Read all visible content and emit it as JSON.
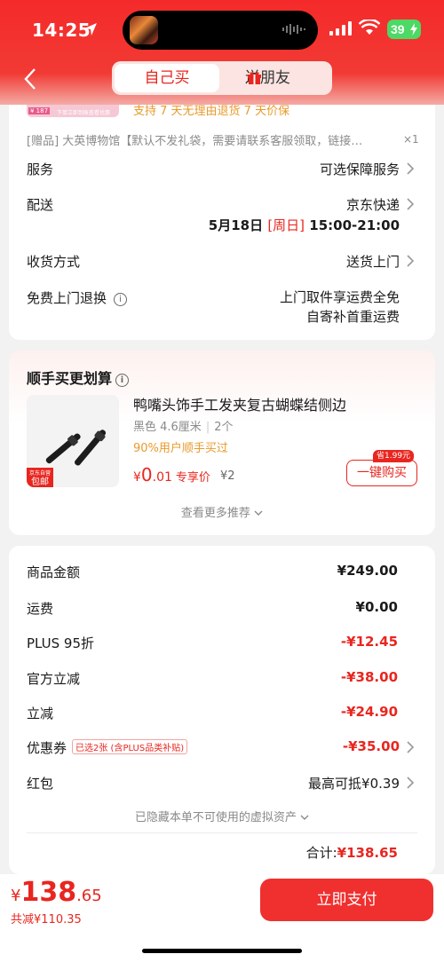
{
  "status_bar": {
    "time": "14:25",
    "battery": "39"
  },
  "header": {
    "tab_self": "自己买",
    "tab_gift": "送朋友"
  },
  "product": {
    "thumb_badge": "¥ 187",
    "thumb_note": "下单立即到账查看优惠",
    "support": "支持 7 天无理由退货  7 天价保",
    "gift_line": "[赠品] 大英博物馆【默认不发礼袋，需要请联系客服领取，链接…",
    "gift_qty": "×1"
  },
  "rows": {
    "service_label": "服务",
    "service_value": "可选保障服务",
    "delivery_label": "配送",
    "delivery_value": "京东快递",
    "delivery_date": "5月18日",
    "delivery_weekday": "[周日]",
    "delivery_time": "15:00-21:00",
    "receive_label": "收货方式",
    "receive_value": "送货上门",
    "return_label": "免费上门退换",
    "return_value_1": "上门取件享运费全免",
    "return_value_2": "自寄补首重运费"
  },
  "bundle": {
    "title": "顺手买更划算",
    "item_title": "鸭嘴头饰手工发夹复古蝴蝶结侧边",
    "spec": "黑色 4.6厘米",
    "count": "2个",
    "pct": "90%用户顺手买过",
    "price_symbol": "¥",
    "price_int": "0",
    "price_dec": ".01",
    "price_tag": "专享价",
    "orig_price": "¥2",
    "save_tag": "省1.99元",
    "buy_label": "一键购买",
    "badge_top": "京东自营",
    "badge_bottom": "包邮",
    "more": "查看更多推荐"
  },
  "summary": {
    "items": [
      {
        "label": "商品金额",
        "value": "¥249.00"
      },
      {
        "label": "运费",
        "value": "¥0.00"
      },
      {
        "label": "PLUS 95折",
        "value": "-¥12.45"
      },
      {
        "label": "官方立减",
        "value": "-¥38.00"
      },
      {
        "label": "立减",
        "value": "-¥24.90"
      },
      {
        "label": "优惠券",
        "value": "-¥35.00",
        "tag": "已选2张 (含PLUS品类补贴)"
      },
      {
        "label": "红包",
        "value": "最高可抵¥0.39"
      }
    ],
    "hidden_note": "已隐藏本单不可使用的虚拟资产",
    "total_label": "合计:",
    "total_value": "¥138.65"
  },
  "footer": {
    "price_symbol": "¥",
    "price_int": "138",
    "price_dec": ".65",
    "saved": "共减¥110.35",
    "pay_label": "立即支付"
  },
  "colors": {
    "brand": "#f42a2a",
    "accent": "#e8261f",
    "warning": "#e89a2b"
  }
}
